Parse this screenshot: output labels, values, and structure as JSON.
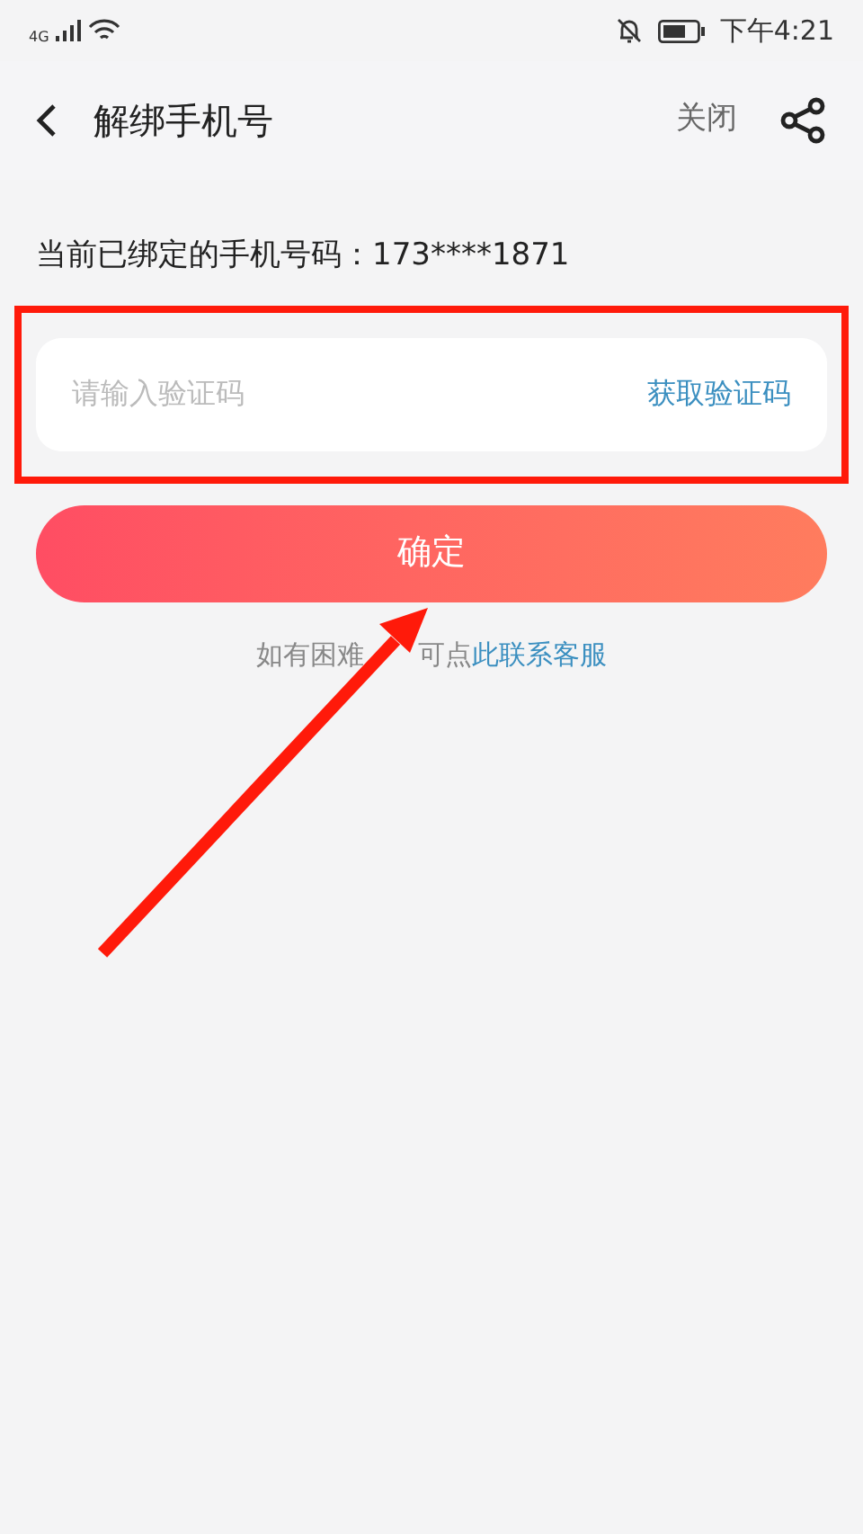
{
  "status_bar": {
    "network": "4G",
    "time": "下午4:21"
  },
  "header": {
    "title": "解绑手机号",
    "close": "关闭"
  },
  "bound_phone": {
    "label": "当前已绑定的手机号码：",
    "number": "173****1871"
  },
  "code_field": {
    "placeholder": "请输入验证码",
    "action": "获取验证码"
  },
  "confirm_button": "确定",
  "help": {
    "before": "如有困难",
    "after": "可点",
    "link": "此联系客服"
  }
}
